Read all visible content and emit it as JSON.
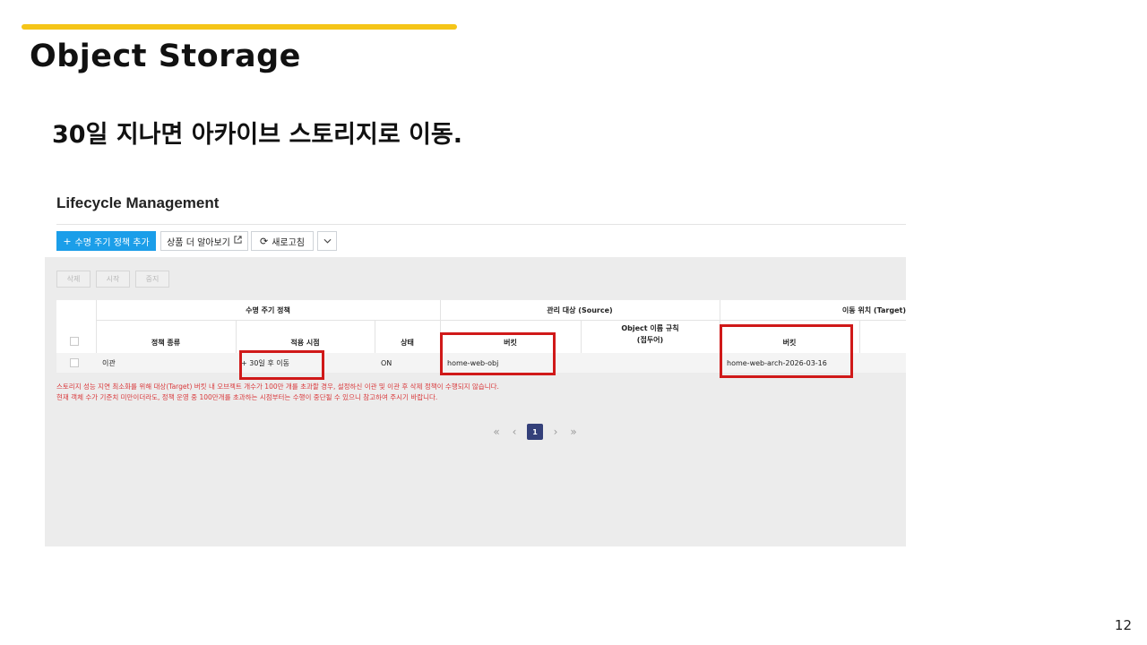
{
  "slide": {
    "title": "Object Storage",
    "subtitle": "30일 지나면 아카이브 스토리지로 이동.",
    "page_number": "12",
    "accent_color": "#f5c518"
  },
  "console": {
    "title": "Lifecycle Management",
    "toolbar": {
      "add_policy_label": "수명 주기 정책 추가",
      "add_policy_icon": "plus-icon",
      "learn_more_label": "상품 더 알아보기",
      "learn_more_icon": "external-link-icon",
      "refresh_label": "새로고침",
      "refresh_icon": "refresh-icon",
      "more_icon": "chevron-down-icon"
    },
    "actions": {
      "delete_label": "삭제",
      "start_label": "시작",
      "stop_label": "중지"
    },
    "table": {
      "group_headers": {
        "policy": "수명 주기 정책",
        "source": "관리 대상 (Source)",
        "target": "이동 위치 (Target)"
      },
      "columns": {
        "policy_type": "정책 종류",
        "apply_time": "적용 시점",
        "status": "상태",
        "source_bucket": "버킷",
        "object_rule_line1": "Object 이름 규칙",
        "object_rule_line2": "(접두어)",
        "target_bucket": "버킷"
      },
      "rows": [
        {
          "policy_type": "이관",
          "apply_time": "+ 30일 후 이동",
          "status": "ON",
          "source_bucket": "home-web-obj",
          "object_rule": "",
          "target_bucket": "home-web-arch-2026-03-16"
        }
      ]
    },
    "notes": {
      "line1": "스토리지 성능 지연 최소화를 위해 대상(Target) 버킷 내 오브젝트 개수가 100만 개를 초과할 경우, 설정하신 이관 및 이관 후 삭제 정책이 수행되지 않습니다.",
      "line2": "현재 객체 수가 기준치 미만이더라도, 정책 운영 중 100만개를 초과하는 시점부터는 수행이 중단될 수 있으니 참고하여 주시기 바랍니다."
    },
    "pagination": {
      "first_icon": "«",
      "prev_icon": "‹",
      "current_page": "1",
      "next_icon": "›",
      "last_icon": "»"
    },
    "primary_color": "#1b9ee9",
    "highlight_color": "#d01919",
    "warning_color": "#d9393b"
  }
}
